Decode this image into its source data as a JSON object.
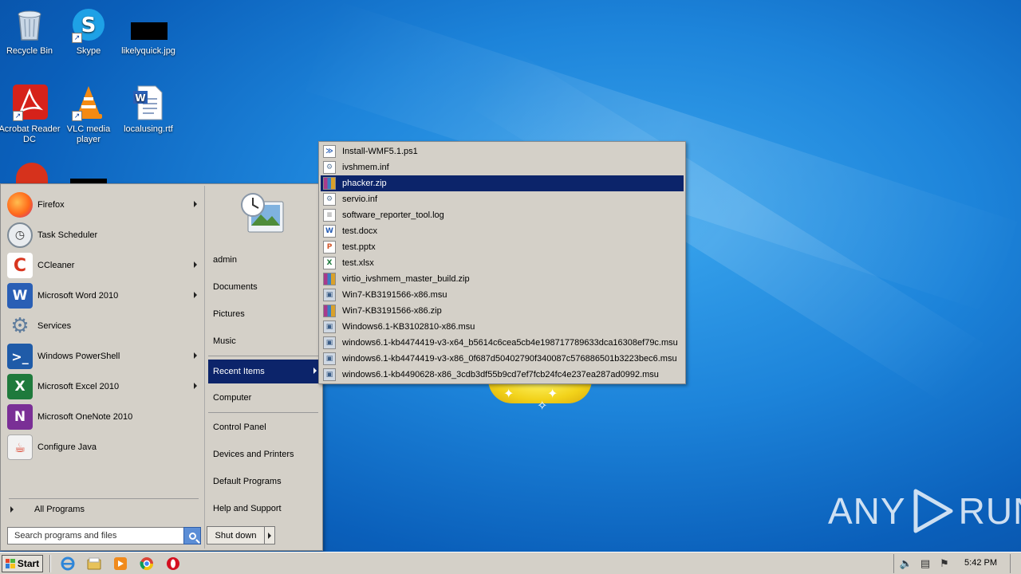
{
  "desktop": {
    "icons": [
      {
        "label": "Recycle Bin",
        "icon": "recycle-bin-icon"
      },
      {
        "label": "Skype",
        "icon": "skype-icon"
      },
      {
        "label": "likelyquick.jpg",
        "icon": "image-file-icon"
      },
      {
        "label": "Acrobat Reader DC",
        "icon": "acrobat-icon"
      },
      {
        "label": "VLC media player",
        "icon": "vlc-icon"
      },
      {
        "label": "localusing.rtf",
        "icon": "word-document-icon"
      }
    ]
  },
  "start_menu": {
    "programs": [
      {
        "label": "Firefox",
        "has_submenu": true
      },
      {
        "label": "Task Scheduler",
        "has_submenu": false
      },
      {
        "label": "CCleaner",
        "has_submenu": true
      },
      {
        "label": "Microsoft Word 2010",
        "has_submenu": true
      },
      {
        "label": "Services",
        "has_submenu": false
      },
      {
        "label": "Windows PowerShell",
        "has_submenu": true
      },
      {
        "label": "Microsoft Excel 2010",
        "has_submenu": true
      },
      {
        "label": "Microsoft OneNote 2010",
        "has_submenu": false
      },
      {
        "label": "Configure Java",
        "has_submenu": false
      }
    ],
    "all_programs": "All Programs",
    "search_placeholder": "Search programs and files",
    "places": [
      {
        "label": "admin"
      },
      {
        "label": "Documents"
      },
      {
        "label": "Pictures"
      },
      {
        "label": "Music"
      },
      {
        "label": "Recent Items",
        "active": true
      },
      {
        "label": "Computer"
      },
      {
        "label": "Control Panel"
      },
      {
        "label": "Devices and Printers"
      },
      {
        "label": "Default Programs"
      },
      {
        "label": "Help and Support"
      }
    ],
    "shutdown_label": "Shut down"
  },
  "recent_items": [
    {
      "name": "Install-WMF5.1.ps1",
      "type": "ps1"
    },
    {
      "name": "ivshmem.inf",
      "type": "inf"
    },
    {
      "name": "phacker.zip",
      "type": "zip",
      "selected": true
    },
    {
      "name": "servio.inf",
      "type": "inf"
    },
    {
      "name": "software_reporter_tool.log",
      "type": "log"
    },
    {
      "name": "test.docx",
      "type": "docx"
    },
    {
      "name": "test.pptx",
      "type": "pptx"
    },
    {
      "name": "test.xlsx",
      "type": "xlsx"
    },
    {
      "name": "virtio_ivshmem_master_build.zip",
      "type": "zip"
    },
    {
      "name": "Win7-KB3191566-x86.msu",
      "type": "msu"
    },
    {
      "name": "Win7-KB3191566-x86.zip",
      "type": "zip"
    },
    {
      "name": "Windows6.1-KB3102810-x86.msu",
      "type": "msu"
    },
    {
      "name": "windows6.1-kb4474419-v3-x64_b5614c6cea5cb4e198717789633dca16308ef79c.msu",
      "type": "msu"
    },
    {
      "name": "windows6.1-kb4474419-v3-x86_0f687d50402790f340087c576886501b3223bec6.msu",
      "type": "msu"
    },
    {
      "name": "windows6.1-kb4490628-x86_3cdb3df55b9cd7ef7fcb24fc4e237ea287ad0992.msu",
      "type": "msu"
    }
  ],
  "taskbar": {
    "start_label": "Start",
    "pinned": [
      "internet-explorer-icon",
      "file-explorer-icon",
      "media-player-icon",
      "chrome-icon",
      "opera-icon"
    ],
    "clock": "5:42 PM"
  },
  "watermark": {
    "left": "ANY",
    "right": "RUN"
  }
}
